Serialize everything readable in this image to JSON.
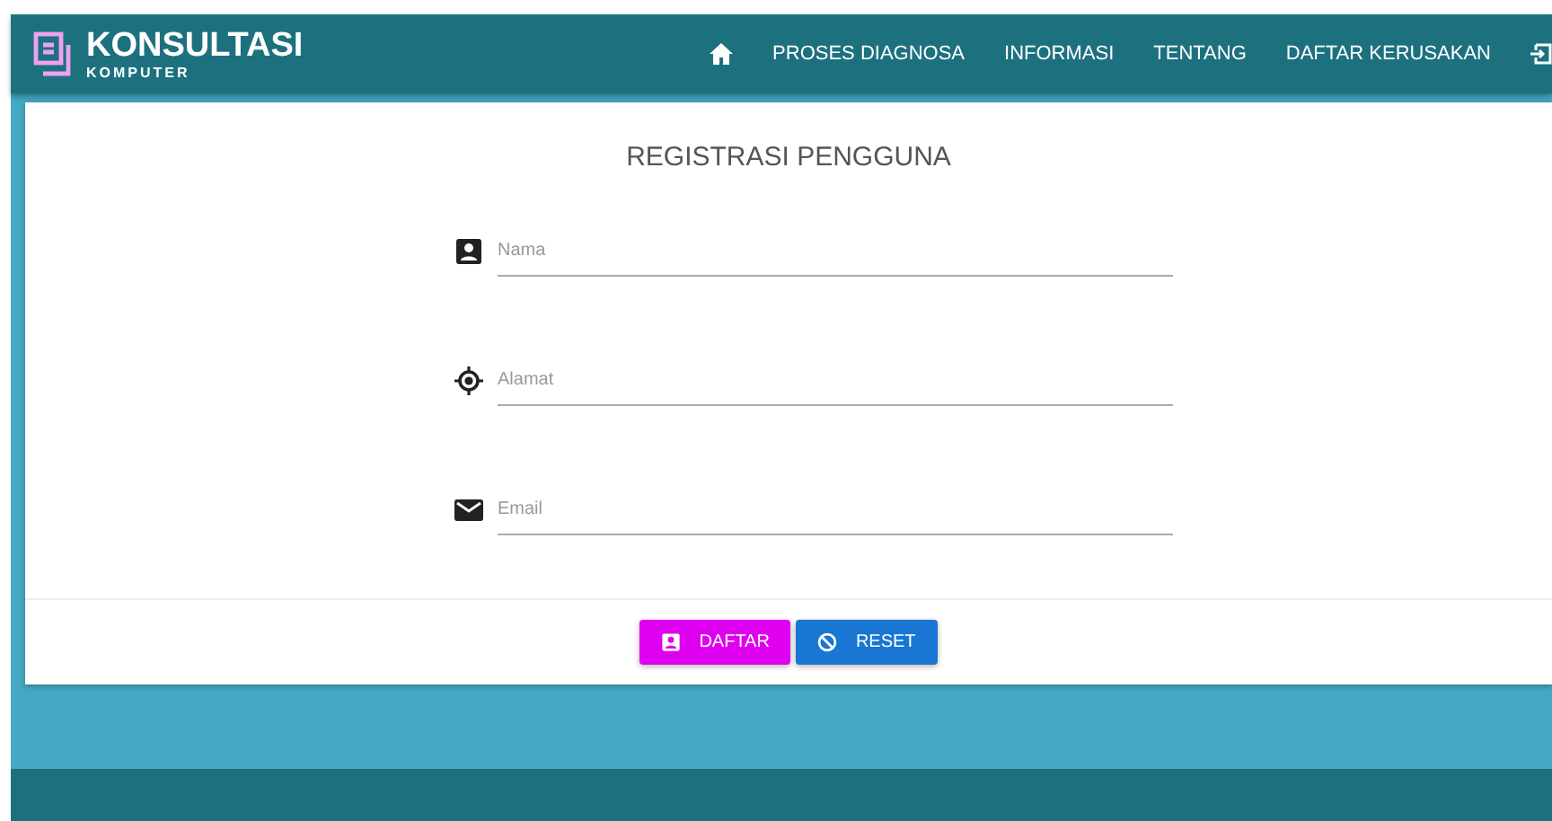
{
  "brand": {
    "title": "KONSULTASI",
    "subtitle": "KOMPUTER"
  },
  "nav": [
    {
      "kind": "home"
    },
    {
      "kind": "text",
      "label": "PROSES DIAGNOSA"
    },
    {
      "kind": "text",
      "label": "INFORMASI"
    },
    {
      "kind": "text",
      "label": "TENTANG"
    },
    {
      "kind": "text",
      "label": "DAFTAR KERUSAKAN"
    },
    {
      "kind": "login"
    }
  ],
  "form": {
    "title": "REGISTRASI PENGGUNA",
    "fields": [
      {
        "kind": "person",
        "placeholder": "Nama"
      },
      {
        "kind": "location",
        "placeholder": "Alamat"
      },
      {
        "kind": "mail",
        "placeholder": "Email"
      }
    ],
    "buttons": [
      {
        "kind": "register",
        "label": "DAFTAR"
      },
      {
        "kind": "reset",
        "label": "RESET"
      }
    ]
  }
}
